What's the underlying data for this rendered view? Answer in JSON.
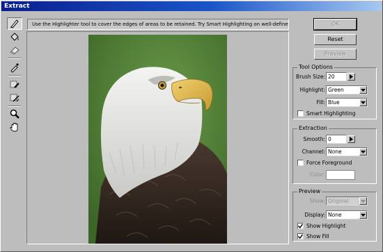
{
  "window": {
    "title": "Extract"
  },
  "instruction": "Use the Highlighter tool to cover the edges of areas to be retained. Try Smart Highlighting on well-defined edges.",
  "tools": [
    {
      "name": "edge-highlighter-tool",
      "icon": "highlighter-icon",
      "active": true
    },
    {
      "name": "fill-tool",
      "icon": "paint-bucket-icon",
      "active": false
    },
    {
      "name": "eraser-tool",
      "icon": "eraser-icon",
      "active": false
    },
    {
      "name": "eyedropper-tool",
      "icon": "eyedropper-icon",
      "active": false
    },
    {
      "name": "cleanup-tool",
      "icon": "cleanup-icon",
      "active": false
    },
    {
      "name": "edge-touchup-tool",
      "icon": "edge-touchup-icon",
      "active": false
    },
    {
      "name": "zoom-tool",
      "icon": "magnifier-icon",
      "active": false
    },
    {
      "name": "hand-tool",
      "icon": "hand-icon",
      "active": false
    }
  ],
  "buttons": {
    "ok": "OK",
    "reset": "Reset",
    "preview": "Preview"
  },
  "tool_options": {
    "title": "Tool Options",
    "brush_size_label": "Brush Size:",
    "brush_size": "20",
    "highlight_label": "Highlight:",
    "highlight": "Green",
    "fill_label": "Fill:",
    "fill": "Blue",
    "smart_highlighting_label": "Smart Highlighting",
    "smart_highlighting": false
  },
  "extraction": {
    "title": "Extraction",
    "smooth_label": "Smooth:",
    "smooth": "0",
    "channel_label": "Channel:",
    "channel": "None",
    "force_foreground_label": "Force Foreground",
    "force_foreground": false,
    "color_label": "Color:"
  },
  "preview": {
    "title": "Preview",
    "show_label": "Show:",
    "show": "Original",
    "display_label": "Display:",
    "display": "None",
    "show_highlight_label": "Show Highlight",
    "show_highlight": true,
    "show_fill_label": "Show Fill",
    "show_fill": true
  },
  "colors": {
    "title_start": "#0a1f8f",
    "title_end": "#a6c8f0",
    "background_green": "#4c7a34"
  }
}
